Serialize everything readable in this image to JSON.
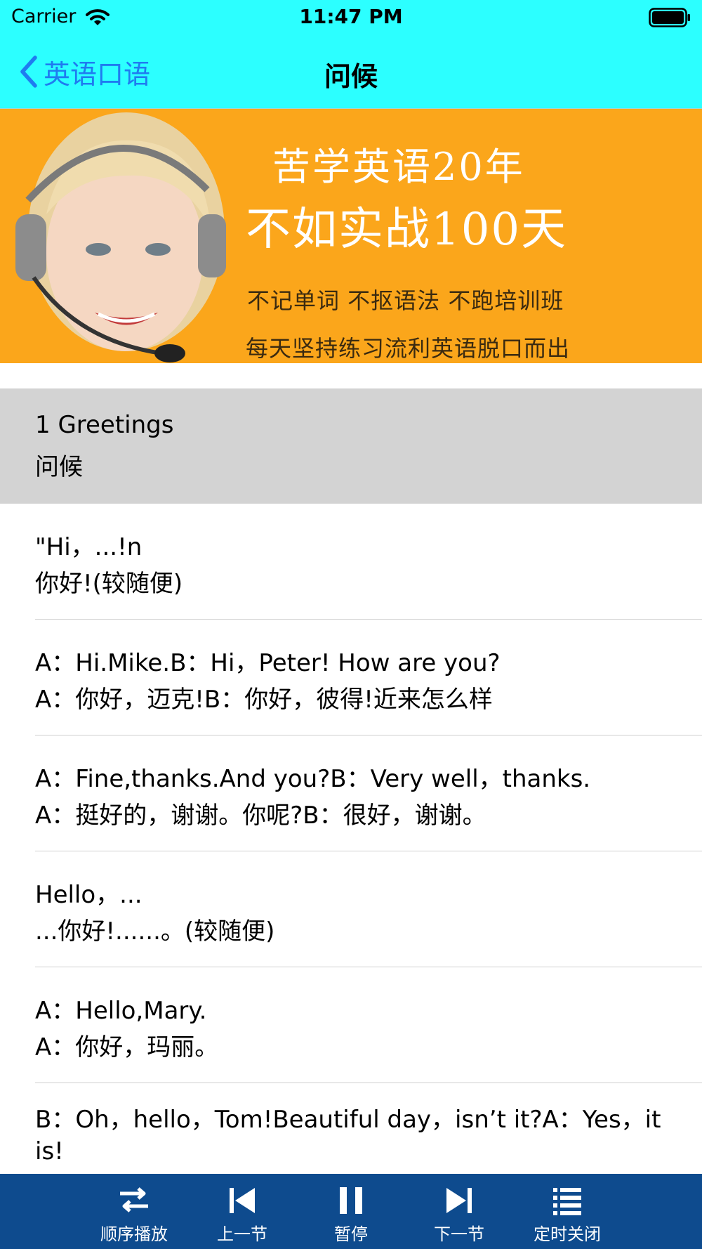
{
  "status_bar": {
    "carrier": "Carrier",
    "time": "11:47 PM"
  },
  "nav": {
    "back_label": "英语口语",
    "title": "问候"
  },
  "banner": {
    "line1": "苦学英语20年",
    "line2": "不如实战100天",
    "line3": "不记单词  不抠语法  不跑培训班",
    "line4": "每天坚持练习流利英语脱口而出"
  },
  "section": {
    "title_en": "1 Greetings",
    "title_zh": "问候"
  },
  "items": [
    {
      "en": "\"Hi，...!n",
      "zh": "你好!(较随便)"
    },
    {
      "en": "A：Hi.Mike.B：Hi，Peter! How are you?",
      "zh": "A：你好，迈克!B：你好，彼得!近来怎么样"
    },
    {
      "en": "A：Fine,thanks.And you?B：Very well，thanks.",
      "zh": "A：挺好的，谢谢。你呢?B：很好，谢谢。"
    },
    {
      "en": "Hello，...",
      "zh": "...你好!......。(较随便)"
    },
    {
      "en": "A：Hello,Mary.",
      "zh": "A：你好，玛丽。"
    },
    {
      "en": "B：Oh，hello，Tom!Beautiful day，isn’t it?A：Yes，it is!",
      "zh": ""
    }
  ],
  "toolbar": {
    "sequential_label": "顺序播放",
    "previous_label": "上一节",
    "pause_label": "暂停",
    "next_label": "下一节",
    "timer_label": "定时关闭"
  },
  "colors": {
    "status_nav_bg": "#2cffff",
    "back_tint": "#1f7bf0",
    "banner_bg": "#fba61b",
    "section_bg": "#d3d3d3",
    "toolbar_bg": "#0e4b8e"
  }
}
